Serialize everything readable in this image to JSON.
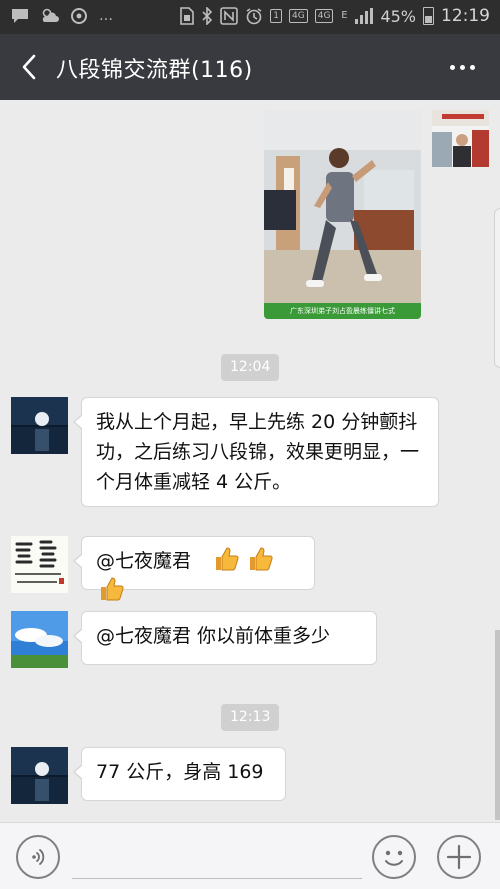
{
  "status_bar": {
    "battery": "45%",
    "time": "12:19",
    "network_labels": [
      "4G",
      "4G",
      "E"
    ],
    "notification_badge": "1"
  },
  "header": {
    "title": "八段锦交流群(116)"
  },
  "messages": {
    "photo_caption": "广东深圳弟子刘占盈晨练僵讲七式",
    "time_1": "12:04",
    "text_1": "我从上个月起，早上先练 20 分钟颤抖功，之后练习八段锦，效果更明显，一个月体重减轻 4 公斤。",
    "mention_2": "@七夜魔君",
    "mention_3": "@七夜魔君  你以前体重多少",
    "time_2": "12:13",
    "text_4": "77 公斤，身高 169"
  },
  "icons": {
    "back": "chevron-left-icon",
    "more": "more-dots-icon",
    "voice": "voice-icon",
    "emoji": "smiley-icon",
    "plus": "plus-icon",
    "thumbs": "thumbs-up-icon"
  },
  "colors": {
    "title_bar": "#393a3f",
    "status_bar": "#2e2e2e",
    "chat_bg": "#ebebeb",
    "bubble_bg": "#ffffff",
    "timestamp_bg": "#d0d0d0",
    "caption_bg": "#3a9a38"
  }
}
